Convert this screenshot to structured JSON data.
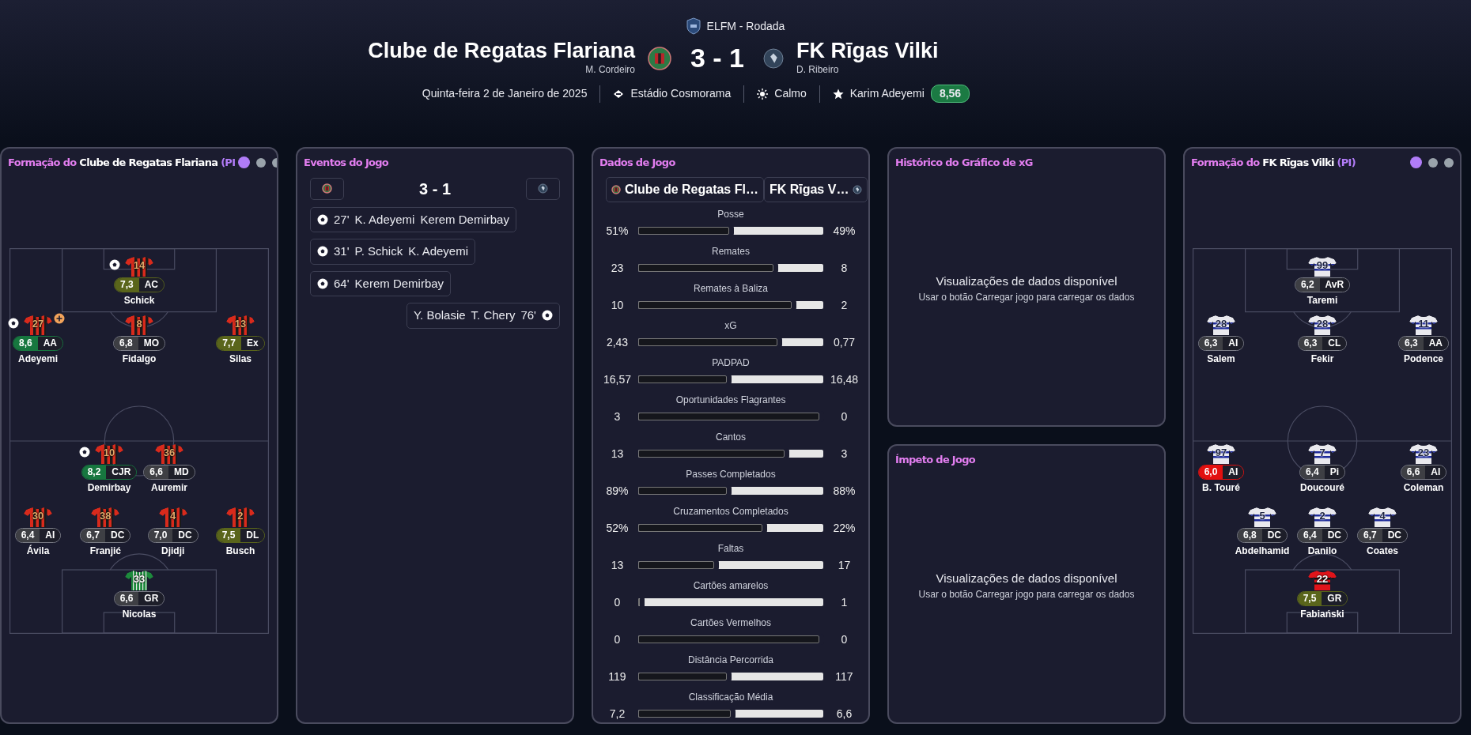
{
  "header": {
    "competition": "ELFM - Rodada",
    "home": {
      "name": "Clube de Regatas Flariana",
      "coach": "M. Cordeiro"
    },
    "score": "3 - 1",
    "away": {
      "name": "FK Rīgas Vilki",
      "coach": "D. Ribeiro"
    },
    "date": "Quinta-feira 2 de Janeiro de 2025",
    "stadium": "Estádio Cosmorama",
    "weather": "Calmo",
    "player_of_match": {
      "name": "Karim Adeyemi",
      "rating": "8,56"
    }
  },
  "home_formation": {
    "title_prefix": "Formação do",
    "team": "Clube de Regatas Flariana",
    "title_suffix": "(PI",
    "pages": [
      {
        "selected": true
      },
      {
        "selected": false
      },
      {
        "selected": false
      }
    ],
    "lines": [
      {
        "compact": true,
        "players": [
          {
            "number": "14",
            "rating": "7,3",
            "position": "AC",
            "name": "Schick",
            "color": "#5a651b",
            "kind": "outfield",
            "scored": true,
            "assisted": false
          }
        ]
      },
      {
        "compact": false,
        "players": [
          {
            "number": "27",
            "rating": "8,6",
            "position": "AA",
            "name": "Adeyemi",
            "color": "#17773f",
            "kind": "outfield",
            "scored": true,
            "assisted": true
          },
          {
            "number": "8",
            "rating": "6,8",
            "position": "MO",
            "name": "Fidalgo",
            "color": "#3e3f44",
            "kind": "outfield",
            "scored": false,
            "assisted": false
          },
          {
            "number": "13",
            "rating": "7,7",
            "position": "Ex",
            "name": "Silas",
            "color": "#5a651b",
            "kind": "outfield",
            "scored": false,
            "assisted": false
          }
        ]
      },
      {
        "compact": true,
        "players": [
          {
            "number": "10",
            "rating": "8,2",
            "position": "CJR",
            "name": "Demirbay",
            "color": "#17773f",
            "kind": "outfield",
            "scored": true,
            "assisted": false
          },
          {
            "number": "36",
            "rating": "6,6",
            "position": "MD",
            "name": "Auremir",
            "color": "#3e3f44",
            "kind": "outfield",
            "scored": false,
            "assisted": false
          }
        ]
      },
      {
        "compact": false,
        "players": [
          {
            "number": "30",
            "rating": "6,4",
            "position": "AI",
            "name": "Ávila",
            "color": "#3e3f44",
            "kind": "outfield",
            "scored": false,
            "assisted": false
          },
          {
            "number": "38",
            "rating": "6,7",
            "position": "DC",
            "name": "Franjić",
            "color": "#3e3f44",
            "kind": "outfield",
            "scored": false,
            "assisted": false
          },
          {
            "number": "4",
            "rating": "7,0",
            "position": "DC",
            "name": "Djidji",
            "color": "#3e3f44",
            "kind": "outfield",
            "scored": false,
            "assisted": false
          },
          {
            "number": "2",
            "rating": "7,5",
            "position": "DL",
            "name": "Busch",
            "color": "#5a651b",
            "kind": "outfield",
            "scored": false,
            "assisted": false
          }
        ]
      },
      {
        "compact": true,
        "players": [
          {
            "number": "33",
            "rating": "6,6",
            "position": "GR",
            "name": "Nicolas",
            "color": "#3e3f44",
            "kind": "keeper",
            "scored": false,
            "assisted": false
          }
        ]
      }
    ]
  },
  "events": {
    "title": "Eventos do Jogo",
    "score": "3 - 1",
    "items": [
      {
        "away": false,
        "minute": "27'",
        "names": [
          "K. Adeyemi",
          "Kerem Demirbay"
        ]
      },
      {
        "away": false,
        "minute": "31'",
        "names": [
          "P. Schick",
          "K. Adeyemi"
        ]
      },
      {
        "away": false,
        "minute": "64'",
        "names": [
          "Kerem Demirbay"
        ]
      },
      {
        "away": true,
        "minute": "76'",
        "names": [
          "Y. Bolasie",
          "T. Chery"
        ]
      }
    ]
  },
  "match_stats": {
    "title": "Dados de Jogo",
    "teams": [
      "Clube de Regatas Fl…",
      "FK Rīgas V…"
    ],
    "rows": [
      {
        "label": "Posse",
        "home": "51%",
        "away": "49%",
        "level": 0.49
      },
      {
        "label": "Remates",
        "home": "23",
        "away": "8",
        "level": 0.73
      },
      {
        "label": "Remates à Baliza",
        "home": "10",
        "away": "2",
        "level": 0.83
      },
      {
        "label": "xG",
        "home": "2,43",
        "away": "0,77",
        "level": 0.75
      },
      {
        "label": "PADPAD",
        "home": "16,57",
        "away": "16,48",
        "level": 0.48
      },
      {
        "label": "Oportunidades Flagrantes",
        "home": "3",
        "away": "0",
        "level": 0.98
      },
      {
        "label": "Cantos",
        "home": "13",
        "away": "3",
        "level": 0.79
      },
      {
        "label": "Passes Completados",
        "home": "89%",
        "away": "88%",
        "level": 0.48
      },
      {
        "label": "Cruzamentos Completados",
        "home": "52%",
        "away": "22%",
        "level": 0.67
      },
      {
        "label": "Faltas",
        "home": "13",
        "away": "17",
        "level": 0.41
      },
      {
        "label": "Cartões amarelos",
        "home": "0",
        "away": "1",
        "level": 0.01
      },
      {
        "label": "Cartões Vermelhos",
        "home": "0",
        "away": "0",
        "level": 0.98
      },
      {
        "label": "Distância Percorrida",
        "home": "119",
        "away": "117",
        "level": 0.48
      },
      {
        "label": "Classificação Média",
        "home": "7,2",
        "away": "6,6",
        "level": 0.5
      }
    ]
  },
  "xg_history": {
    "title": "Histórico do Gráfico de xG",
    "message": "Visualizações de dados disponível",
    "hint": "Usar o botão Carregar jogo para carregar os dados"
  },
  "momentum": {
    "title": "Ímpeto de Jogo",
    "message": "Visualizações de dados disponível",
    "hint": "Usar o botão Carregar jogo para carregar os dados"
  },
  "away_formation": {
    "title_prefix": "Formação do",
    "team": "FK Rīgas Vilki",
    "title_suffix": "(PI)",
    "pages": [
      {
        "selected": true
      },
      {
        "selected": false
      },
      {
        "selected": false
      }
    ],
    "lines": [
      {
        "compact": true,
        "players": [
          {
            "number": "99",
            "rating": "6,2",
            "position": "AvR",
            "name": "Taremi",
            "color": "#3e3f44",
            "kind": "outfield",
            "scored": false,
            "assisted": false
          }
        ]
      },
      {
        "compact": false,
        "players": [
          {
            "number": "28",
            "rating": "6,3",
            "position": "AI",
            "name": "Salem",
            "color": "#3e3f44",
            "kind": "outfield",
            "scored": false,
            "assisted": false
          },
          {
            "number": "28",
            "rating": "6,3",
            "position": "CL",
            "name": "Fekir",
            "color": "#3e3f44",
            "kind": "outfield",
            "scored": false,
            "assisted": false
          },
          {
            "number": "11",
            "rating": "6,3",
            "position": "AA",
            "name": "Podence",
            "color": "#3e3f44",
            "kind": "outfield",
            "scored": false,
            "assisted": false
          }
        ]
      },
      {
        "compact": false,
        "players": [
          {
            "number": "97",
            "rating": "6,0",
            "position": "AI",
            "name": "B. Touré",
            "color": "#e3100f",
            "kind": "outfield",
            "scored": false,
            "assisted": false
          },
          {
            "number": "7",
            "rating": "6,4",
            "position": "Pi",
            "name": "Doucouré",
            "color": "#3e3f44",
            "kind": "outfield",
            "scored": false,
            "assisted": false
          },
          {
            "number": "23",
            "rating": "6,6",
            "position": "AI",
            "name": "Coleman",
            "color": "#3e3f44",
            "kind": "outfield",
            "scored": false,
            "assisted": false
          }
        ]
      },
      {
        "compact": true,
        "players": [
          {
            "number": "5",
            "rating": "6,8",
            "position": "DC",
            "name": "Abdelhamid",
            "color": "#3e3f44",
            "kind": "outfield",
            "scored": false,
            "assisted": false
          },
          {
            "number": "2",
            "rating": "6,4",
            "position": "DC",
            "name": "Danilo",
            "color": "#3e3f44",
            "kind": "outfield",
            "scored": false,
            "assisted": false
          },
          {
            "number": "4",
            "rating": "6,7",
            "position": "DC",
            "name": "Coates",
            "color": "#3e3f44",
            "kind": "outfield",
            "scored": false,
            "assisted": false
          }
        ]
      },
      {
        "compact": true,
        "players": [
          {
            "number": "22",
            "rating": "7,5",
            "position": "GR",
            "name": "Fabiański",
            "color": "#5a651b",
            "kind": "keeper",
            "scored": false,
            "assisted": false
          }
        ]
      }
    ]
  }
}
